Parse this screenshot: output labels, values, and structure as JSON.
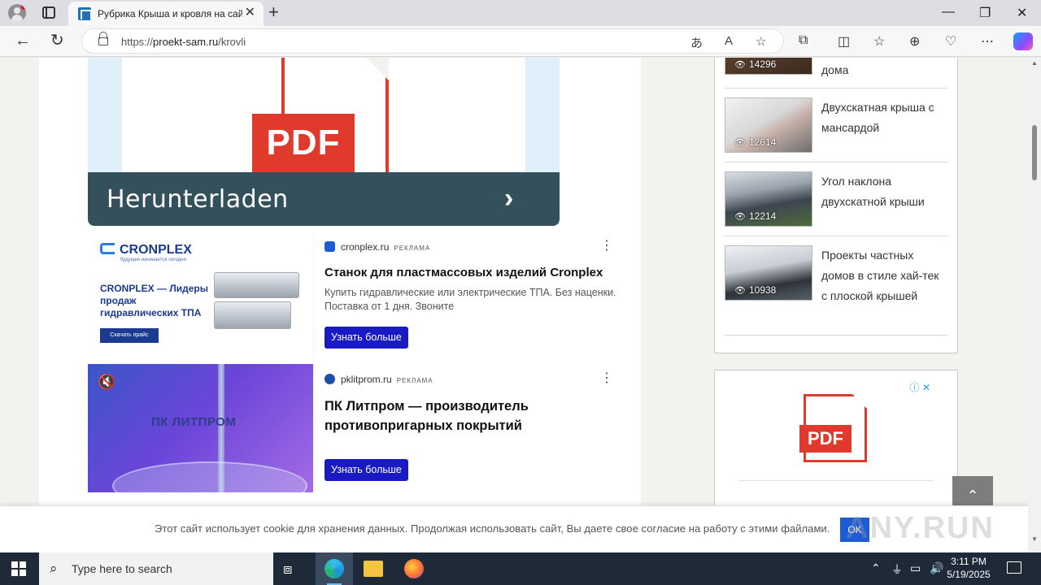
{
  "browser": {
    "tab_title": "Рубрика Крыша и кровля на сайте",
    "url_host": "proekt-sam.ru",
    "url_prefix": "https://",
    "url_path": "/krovli"
  },
  "content": {
    "pdf_ad": {
      "badge": "PDF",
      "cta": "Herunterladen"
    },
    "ads": [
      {
        "domain": "cronplex.ru",
        "label": "РЕКЛАМА",
        "title": "Станок для пластмассовых изделий Cronplex",
        "description": "Купить гидравлические или электрические ТПА. Без наценки. Поставка от 1 дня. Звоните",
        "button": "Узнать больше",
        "image": {
          "logo": "CRONPLEX",
          "tagline": "будущее начинается сегодня",
          "headline": "CRONPLEX — Лидеры продаж гидравлических ТПА",
          "download": "Скачать прайс"
        }
      },
      {
        "domain": "pklitprom.ru",
        "label": "РЕКЛАМА",
        "title": "ПК Литпром — производитель противопригарных покрытий",
        "description": "",
        "button": "Узнать больше",
        "image": {
          "logo": "ПК ЛИТПРОМ"
        }
      }
    ]
  },
  "sidebar": {
    "popular": [
      {
        "title": "дома",
        "views": "14296"
      },
      {
        "title": "Двухскатная крыша с мансардой",
        "views": "12614"
      },
      {
        "title": "Угол наклона двухскатной крыши",
        "views": "12214"
      },
      {
        "title": "Проекты частных домов в стиле хай-тек с плоской крышей",
        "views": "10938"
      }
    ],
    "ad_widget": {
      "badge": "PDF"
    }
  },
  "cookie": {
    "text": "Этот сайт использует cookie для хранения данных. Продолжая использовать сайт, Вы даете свое согласие на работу с этими файлами.",
    "ok": "OK"
  },
  "watermark": "ANY.RUN",
  "taskbar": {
    "search_placeholder": "Type here to search",
    "time": "3:11 PM",
    "date": "5/19/2025"
  },
  "colors": {
    "accent": "#1e5bd6",
    "pdf_red": "#e03a2d",
    "dl_bar": "#33505c",
    "ad_button": "#1a1ac4"
  }
}
